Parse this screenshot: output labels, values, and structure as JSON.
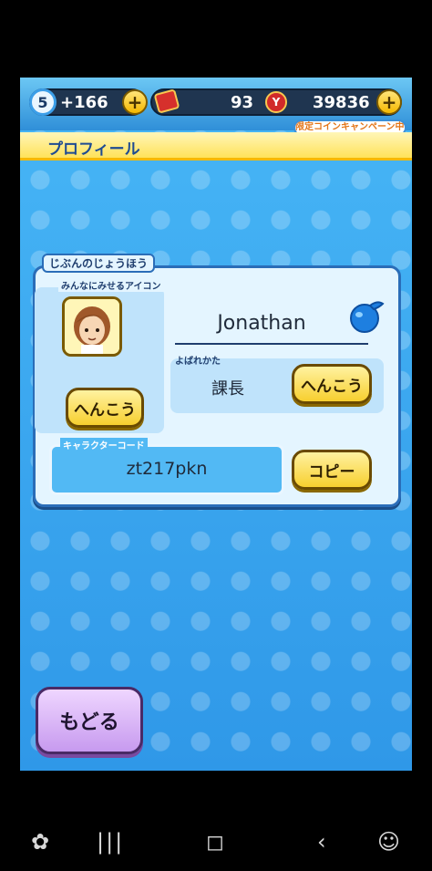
{
  "header": {
    "level": "5",
    "stamina_text": "+166",
    "tickets": "93",
    "coins": "39836",
    "campaign": "限定コインキャンペーン中!"
  },
  "title": "プロフィール",
  "panel": {
    "label": "じぶんのじょうほう",
    "icon_label": "みんなにみせるアイコン",
    "change_icon_label": "へんこう",
    "player_name": "Jonathan",
    "nickname_label": "よばれかた",
    "nickname": "課長",
    "change_nickname_label": "へんこう",
    "code_label": "キャラクターコード",
    "code": "zt217pkn",
    "copy_label": "コピー"
  },
  "back_label": "もどる",
  "colors": {
    "accent": "#f7cf2e",
    "panel_border": "#2a6db8",
    "background": "#3aa6ef",
    "back_button": "#c79aef"
  },
  "icons": [
    "plus-icon",
    "ticket-icon",
    "coin-icon",
    "bubble-icon",
    "avatar-icon",
    "games-icon",
    "recent-apps-icon",
    "home-icon",
    "back-icon",
    "accessibility-icon"
  ]
}
